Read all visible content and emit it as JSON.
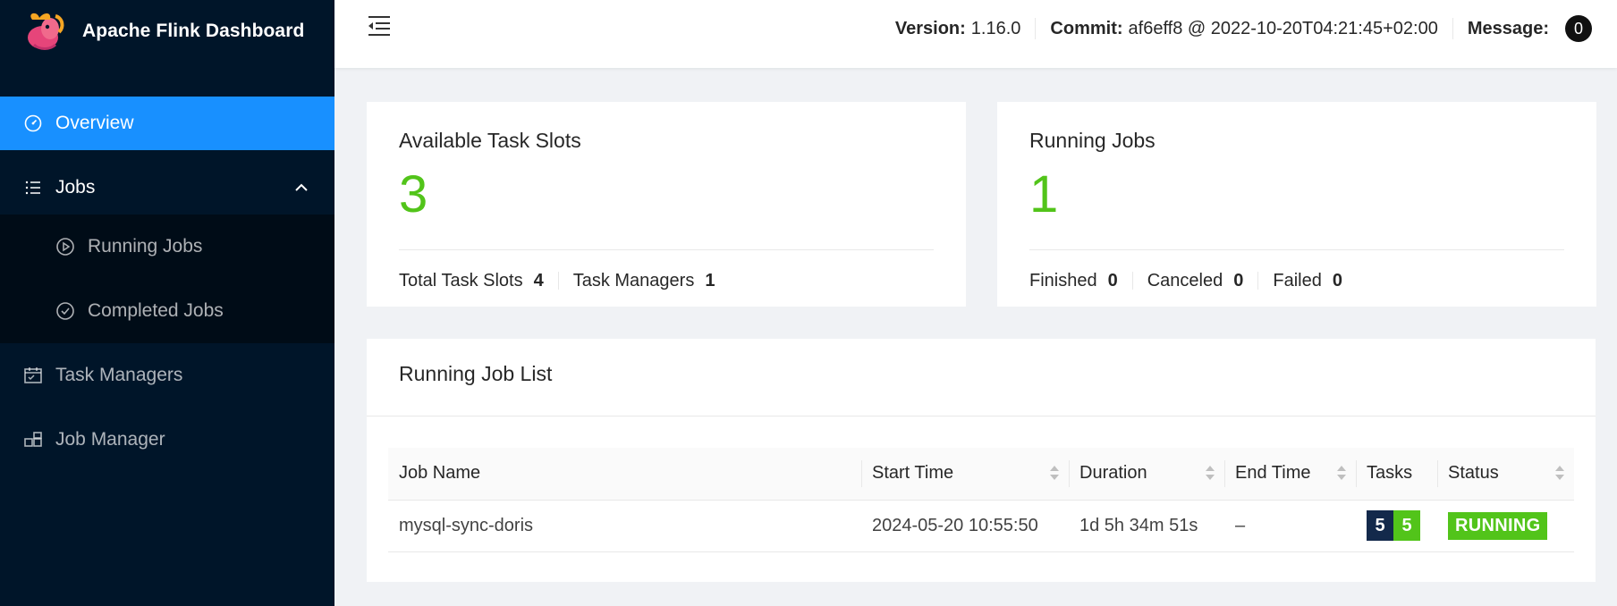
{
  "brand": {
    "name": "Apache Flink Dashboard"
  },
  "sidebar": {
    "items": [
      {
        "label": "Overview"
      },
      {
        "label": "Jobs"
      },
      {
        "label": "Running Jobs"
      },
      {
        "label": "Completed Jobs"
      },
      {
        "label": "Task Managers"
      },
      {
        "label": "Job Manager"
      }
    ]
  },
  "header": {
    "version_label": "Version:",
    "version_value": "1.16.0",
    "commit_label": "Commit:",
    "commit_value": "af6eff8 @ 2022-10-20T04:21:45+02:00",
    "message_label": "Message:",
    "message_count": "0"
  },
  "slots_card": {
    "title": "Available Task Slots",
    "value": "3",
    "total_label": "Total Task Slots",
    "total_value": "4",
    "tm_label": "Task Managers",
    "tm_value": "1"
  },
  "jobs_card": {
    "title": "Running Jobs",
    "value": "1",
    "finished_label": "Finished",
    "finished_value": "0",
    "canceled_label": "Canceled",
    "canceled_value": "0",
    "failed_label": "Failed",
    "failed_value": "0"
  },
  "job_list": {
    "title": "Running Job List",
    "columns": [
      "Job Name",
      "Start Time",
      "Duration",
      "End Time",
      "Tasks",
      "Status"
    ],
    "rows": [
      {
        "name": "mysql-sync-doris",
        "start": "2024-05-20 10:55:50",
        "duration": "1d 5h 34m 51s",
        "end": "–",
        "tasks_total": "5",
        "tasks_running": "5",
        "status": "RUNNING"
      }
    ]
  },
  "colors": {
    "accent": "#1890ff",
    "sidebar_bg": "#001529",
    "success": "#52c41a",
    "task_total_bg": "#13294b"
  }
}
